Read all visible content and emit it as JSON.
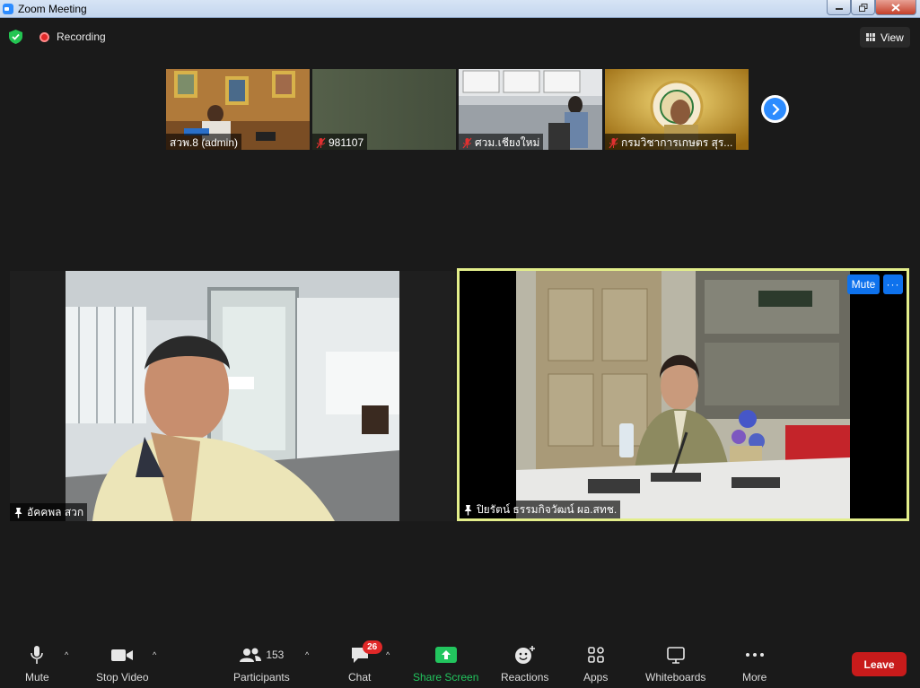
{
  "window": {
    "title": "Zoom Meeting"
  },
  "topbar": {
    "recording_label": "Recording",
    "view_label": "View"
  },
  "thumbnails": [
    {
      "name": "สวพ.8 (admin)",
      "muted": false
    },
    {
      "name": "981107",
      "muted": true
    },
    {
      "name": "ศวม.เชียงใหม่",
      "muted": true
    },
    {
      "name": "กรมวิชาการเกษตร สุร...",
      "muted": true
    }
  ],
  "tiles": {
    "left": {
      "name": "อัคคพล สวก",
      "pinned": true
    },
    "right": {
      "name": "ปิยรัตน์ ธรรมกิจวัฒน์ ผอ.สทช.",
      "pinned": true,
      "mute_label": "Mute",
      "more_label": "···",
      "active_speaker_color": "#e3ee8b"
    }
  },
  "toolbar": {
    "mute": "Mute",
    "stop_video": "Stop Video",
    "participants": "Participants",
    "participants_count": "153",
    "chat": "Chat",
    "chat_badge": "26",
    "share_screen": "Share Screen",
    "reactions": "Reactions",
    "apps": "Apps",
    "whiteboards": "Whiteboards",
    "more": "More",
    "leave": "Leave",
    "share_color": "#22c55e"
  }
}
